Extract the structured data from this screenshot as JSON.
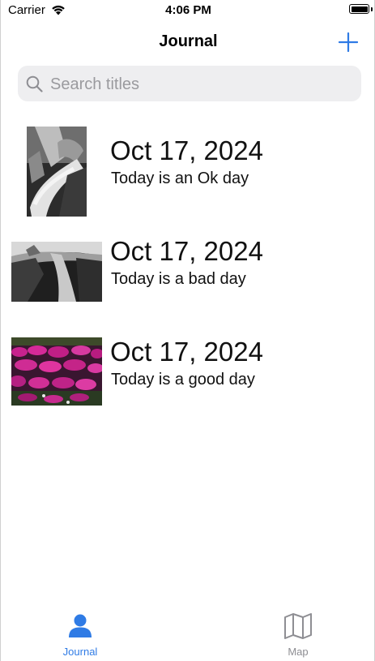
{
  "status_bar": {
    "carrier": "Carrier",
    "time": "4:06 PM",
    "wifi_icon": "wifi-icon",
    "battery_icon": "battery-icon",
    "battery_level": 1.0
  },
  "nav": {
    "title": "Journal",
    "add_icon": "plus-icon"
  },
  "search": {
    "placeholder": "Search titles",
    "value": "",
    "icon": "magnifying-glass-icon"
  },
  "entries": [
    {
      "date": "Oct 17, 2024",
      "text": "Today is an Ok day"
    },
    {
      "date": "Oct 17, 2024",
      "text": "Today is a bad day"
    },
    {
      "date": "Oct 17, 2024",
      "text": "Today is a good day"
    }
  ],
  "tabs": [
    {
      "label": "Journal",
      "icon": "person-icon",
      "selected": true
    },
    {
      "label": "Map",
      "icon": "map-icon",
      "selected": false
    }
  ],
  "colors": {
    "accent": "#2f7be5",
    "inactive_tab": "#8e8e93",
    "search_bg": "#eeeef0"
  }
}
